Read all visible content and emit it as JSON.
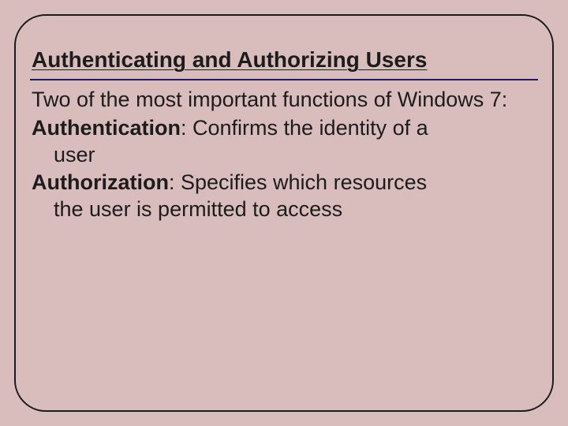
{
  "title": "Authenticating and Authorizing Users",
  "intro": "Two of the most important functions of Windows 7:",
  "items": [
    {
      "term": "Authentication",
      "desc_first": ": Confirms the identity of a",
      "desc_rest": "user"
    },
    {
      "term": "Authorization",
      "desc_first": ": Specifies which resources",
      "desc_rest": "the user is permitted to access"
    }
  ]
}
